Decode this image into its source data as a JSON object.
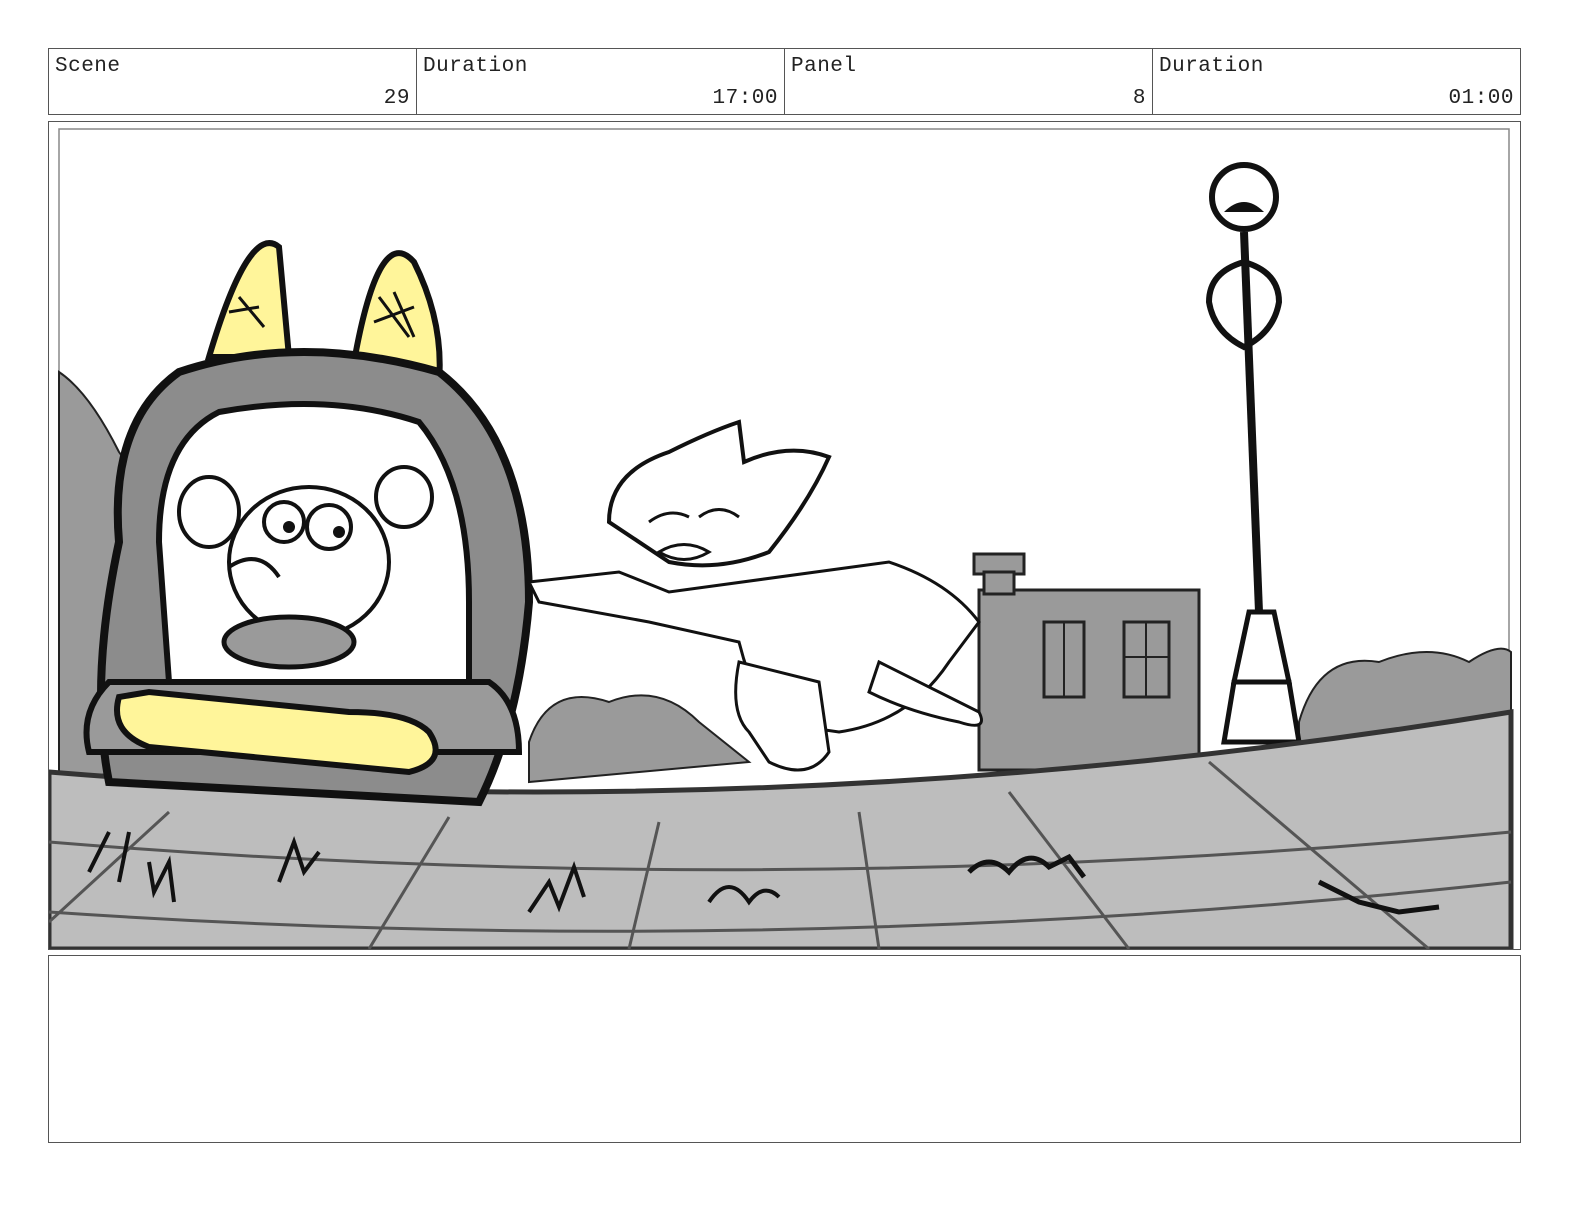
{
  "header": {
    "scene_label": "Scene",
    "scene_value": "29",
    "scene_duration_label": "Duration",
    "scene_duration_value": "17:00",
    "panel_label": "Panel",
    "panel_value": "8",
    "panel_duration_label": "Duration",
    "panel_duration_value": "01:00"
  },
  "notes": {
    "text": ""
  },
  "colors": {
    "accent_yellow": "#fff59a",
    "gray_fill": "#9a9a9a",
    "light_gray": "#c4c4c4",
    "ink": "#111111"
  }
}
